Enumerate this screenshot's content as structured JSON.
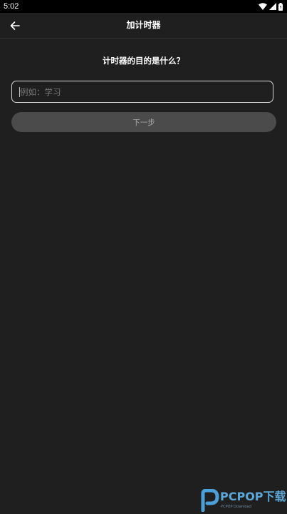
{
  "status_bar": {
    "time": "5:02",
    "icons": [
      "wifi-icon",
      "signal-icon",
      "battery-icon"
    ]
  },
  "app_bar": {
    "title": "加计时器",
    "back_icon": "arrow-left-icon"
  },
  "form": {
    "question": "计时器的目的是什么？",
    "input_placeholder": "例如：学习",
    "input_value": "",
    "next_button_label": "下一步"
  },
  "watermark": {
    "text": "PCPOP下载",
    "subtext": "PCPOP Download"
  },
  "colors": {
    "background": "#1f1f1f",
    "status_bar": "#000000",
    "input_border": "#d8d8d8",
    "button_bg": "#4b4b4b",
    "button_text": "#a8a8a8",
    "watermark": "#5aa7d8"
  }
}
